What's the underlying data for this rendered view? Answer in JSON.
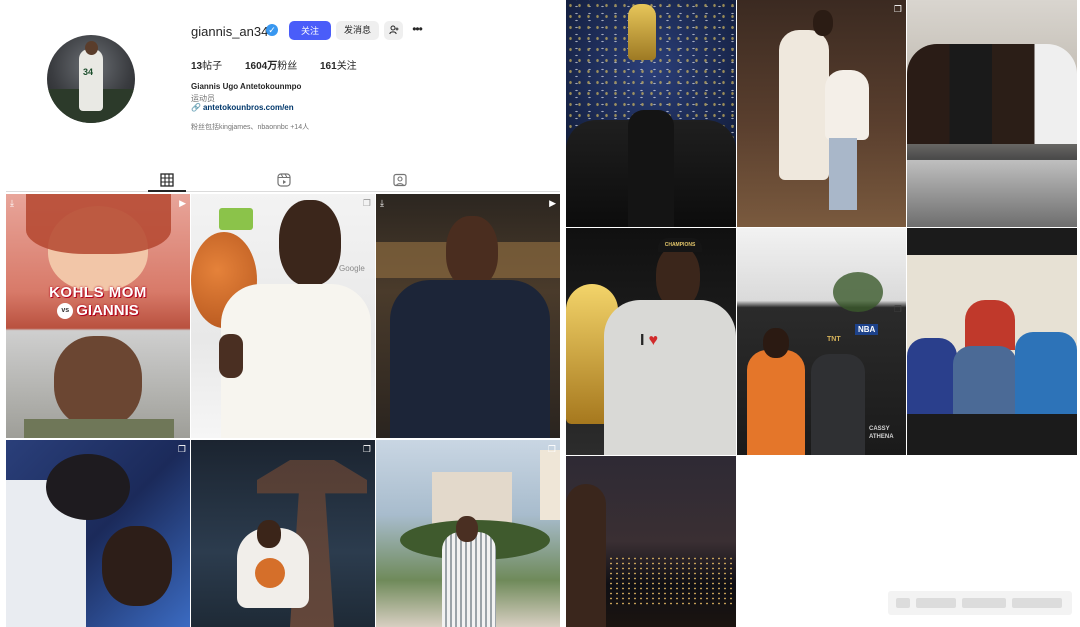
{
  "profile": {
    "username": "giannis_an34",
    "follow_label": "关注",
    "message_label": "发消息",
    "suggest_icon": "add-person-icon",
    "more_icon": "more-dots-icon",
    "posts_count": "13",
    "posts_label": "帖子",
    "followers_count": "1604万",
    "followers_label": "粉丝",
    "following_count": "161",
    "following_label": "关注",
    "full_name": "Giannis Ugo Antetokounmpo",
    "category": "运动员",
    "website": "antetokounbros.com/en",
    "followed_by": "粉丝包括kingjames、nbaonnbc +14人"
  },
  "tabs": [
    {
      "name": "posts",
      "icon": "grid-icon",
      "active": true
    },
    {
      "name": "reels",
      "icon": "reels-icon",
      "active": false
    },
    {
      "name": "tagged",
      "icon": "tagged-icon",
      "active": false
    }
  ],
  "posts": {
    "kohls_title": "KOHLS MOM",
    "kohls_vs": "vs",
    "kohls_name": "GIANNIS",
    "google_text": "Google",
    "trophy_cap": "CHAMPIONS",
    "tee_letter": "I",
    "nba_logo": "NBA",
    "tnt_logo": "TNT",
    "photo_credit_1": "CASSY",
    "photo_credit_2": "ATHENA"
  },
  "colors": {
    "accent": "#4a5df9",
    "verified": "#3897f0",
    "link": "#00376b",
    "kohls_red": "#d0021b"
  }
}
